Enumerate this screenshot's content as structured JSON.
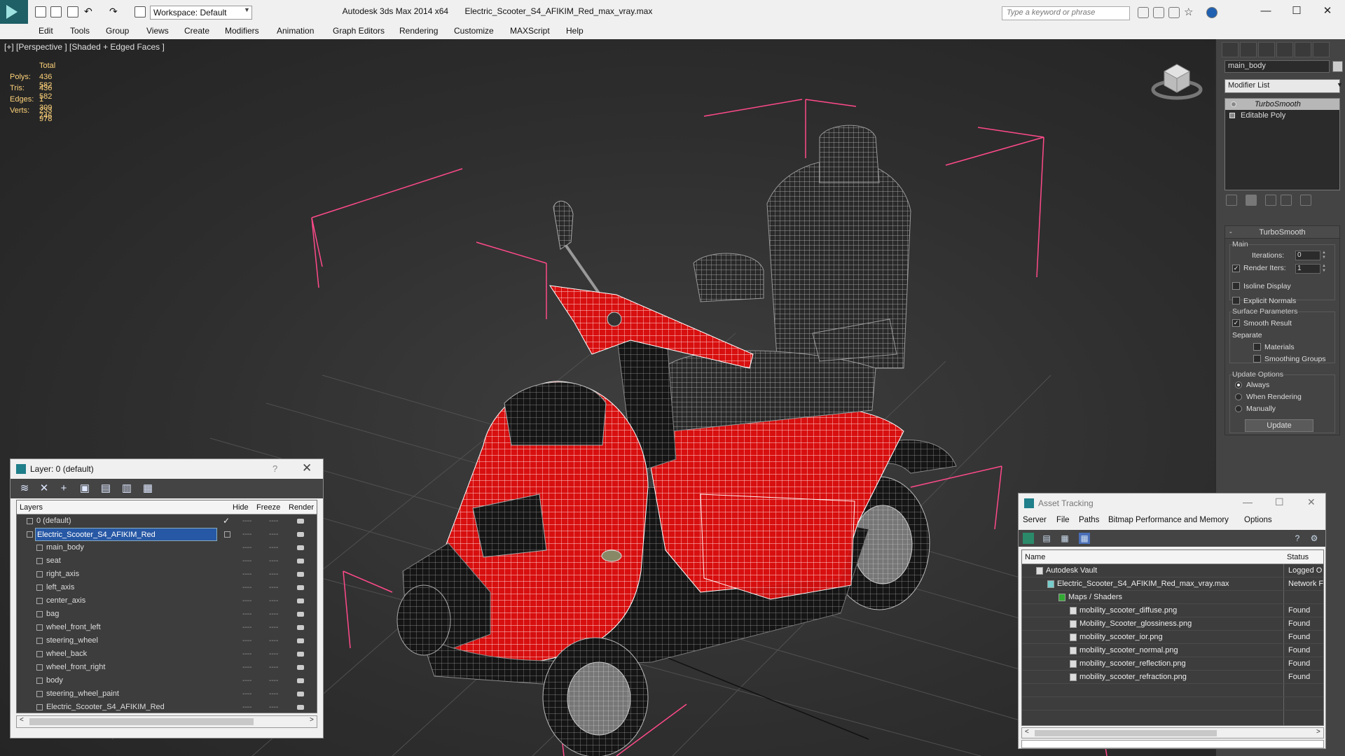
{
  "app": {
    "title": "Autodesk 3ds Max  2014 x64",
    "file": "Electric_Scooter_S4_AFIKIM_Red_max_vray.max",
    "workspace": "Workspace: Default",
    "search_placeholder": "Type a keyword or phrase",
    "minimize": "—",
    "maximize": "☐",
    "close": "✕"
  },
  "menu": [
    "Edit",
    "Tools",
    "Group",
    "Views",
    "Create",
    "Modifiers",
    "Animation",
    "Graph Editors",
    "Rendering",
    "Customize",
    "MAXScript",
    "Help"
  ],
  "viewport": {
    "label": "[+] [Perspective ] [Shaded + Edged Faces ]",
    "stats": {
      "header": "Total",
      "rows": [
        {
          "k": "Polys:",
          "v": "436 582"
        },
        {
          "k": "Tris:",
          "v": "436 582"
        },
        {
          "k": "Edges:",
          "v": "1 309 746"
        },
        {
          "k": "Verts:",
          "v": "233 978"
        }
      ]
    }
  },
  "command_panel": {
    "object_name": "main_body",
    "modifier_list": "Modifier List",
    "stack": [
      "TurboSmooth",
      "Editable Poly"
    ],
    "rollout": "TurboSmooth",
    "main_label": "Main",
    "iterations_label": "Iterations:",
    "iterations_value": "0",
    "render_iters_label": "Render Iters:",
    "render_iters_value": "1",
    "isoline": "Isoline Display",
    "explicit": "Explicit Normals",
    "surface_label": "Surface Parameters",
    "smooth_result": "Smooth Result",
    "separate_label": "Separate",
    "materials": "Materials",
    "smoothing_groups": "Smoothing Groups",
    "update_label": "Update Options",
    "always": "Always",
    "when_rendering": "When Rendering",
    "manually": "Manually",
    "update_button": "Update"
  },
  "layer_window": {
    "title": "Layer: 0 (default)",
    "help": "?",
    "close": "✕",
    "columns": [
      "Layers",
      "Hide",
      "Freeze",
      "Render"
    ],
    "rows": [
      {
        "name": "0 (default)",
        "indent": 0,
        "checked": true
      },
      {
        "name": "Electric_Scooter_S4_AFIKIM_Red",
        "indent": 0,
        "selected": true
      },
      {
        "name": "main_body",
        "indent": 1
      },
      {
        "name": "seat",
        "indent": 1
      },
      {
        "name": "right_axis",
        "indent": 1
      },
      {
        "name": "left_axis",
        "indent": 1
      },
      {
        "name": "center_axis",
        "indent": 1
      },
      {
        "name": "bag",
        "indent": 1
      },
      {
        "name": "wheel_front_left",
        "indent": 1
      },
      {
        "name": "steering_wheel",
        "indent": 1
      },
      {
        "name": "wheel_back",
        "indent": 1
      },
      {
        "name": "wheel_front_right",
        "indent": 1
      },
      {
        "name": "body",
        "indent": 1
      },
      {
        "name": "steering_wheel_paint",
        "indent": 1
      },
      {
        "name": "Electric_Scooter_S4_AFIKIM_Red",
        "indent": 1
      }
    ]
  },
  "asset_tracking": {
    "title": "Asset Tracking",
    "menu": [
      "Server",
      "File",
      "Paths",
      "Bitmap Performance and Memory",
      "Options"
    ],
    "columns": [
      "Name",
      "Status"
    ],
    "rows": [
      {
        "name": "Autodesk Vault",
        "status": "Logged O",
        "indent": 1
      },
      {
        "name": "Electric_Scooter_S4_AFIKIM_Red_max_vray.max",
        "status": "Network F",
        "indent": 2
      },
      {
        "name": "Maps / Shaders",
        "status": "",
        "indent": 3
      },
      {
        "name": "mobility_scooter_diffuse.png",
        "status": "Found",
        "indent": 4
      },
      {
        "name": "Mobility_Scooter_glossiness.png",
        "status": "Found",
        "indent": 4
      },
      {
        "name": "mobility_scooter_ior.png",
        "status": "Found",
        "indent": 4
      },
      {
        "name": "mobility_scooter_normal.png",
        "status": "Found",
        "indent": 4
      },
      {
        "name": "mobility_scooter_reflection.png",
        "status": "Found",
        "indent": 4
      },
      {
        "name": "mobility_scooter_refraction.png",
        "status": "Found",
        "indent": 4
      },
      {
        "name": "",
        "status": "",
        "indent": 0
      },
      {
        "name": "",
        "status": "",
        "indent": 0
      }
    ]
  }
}
